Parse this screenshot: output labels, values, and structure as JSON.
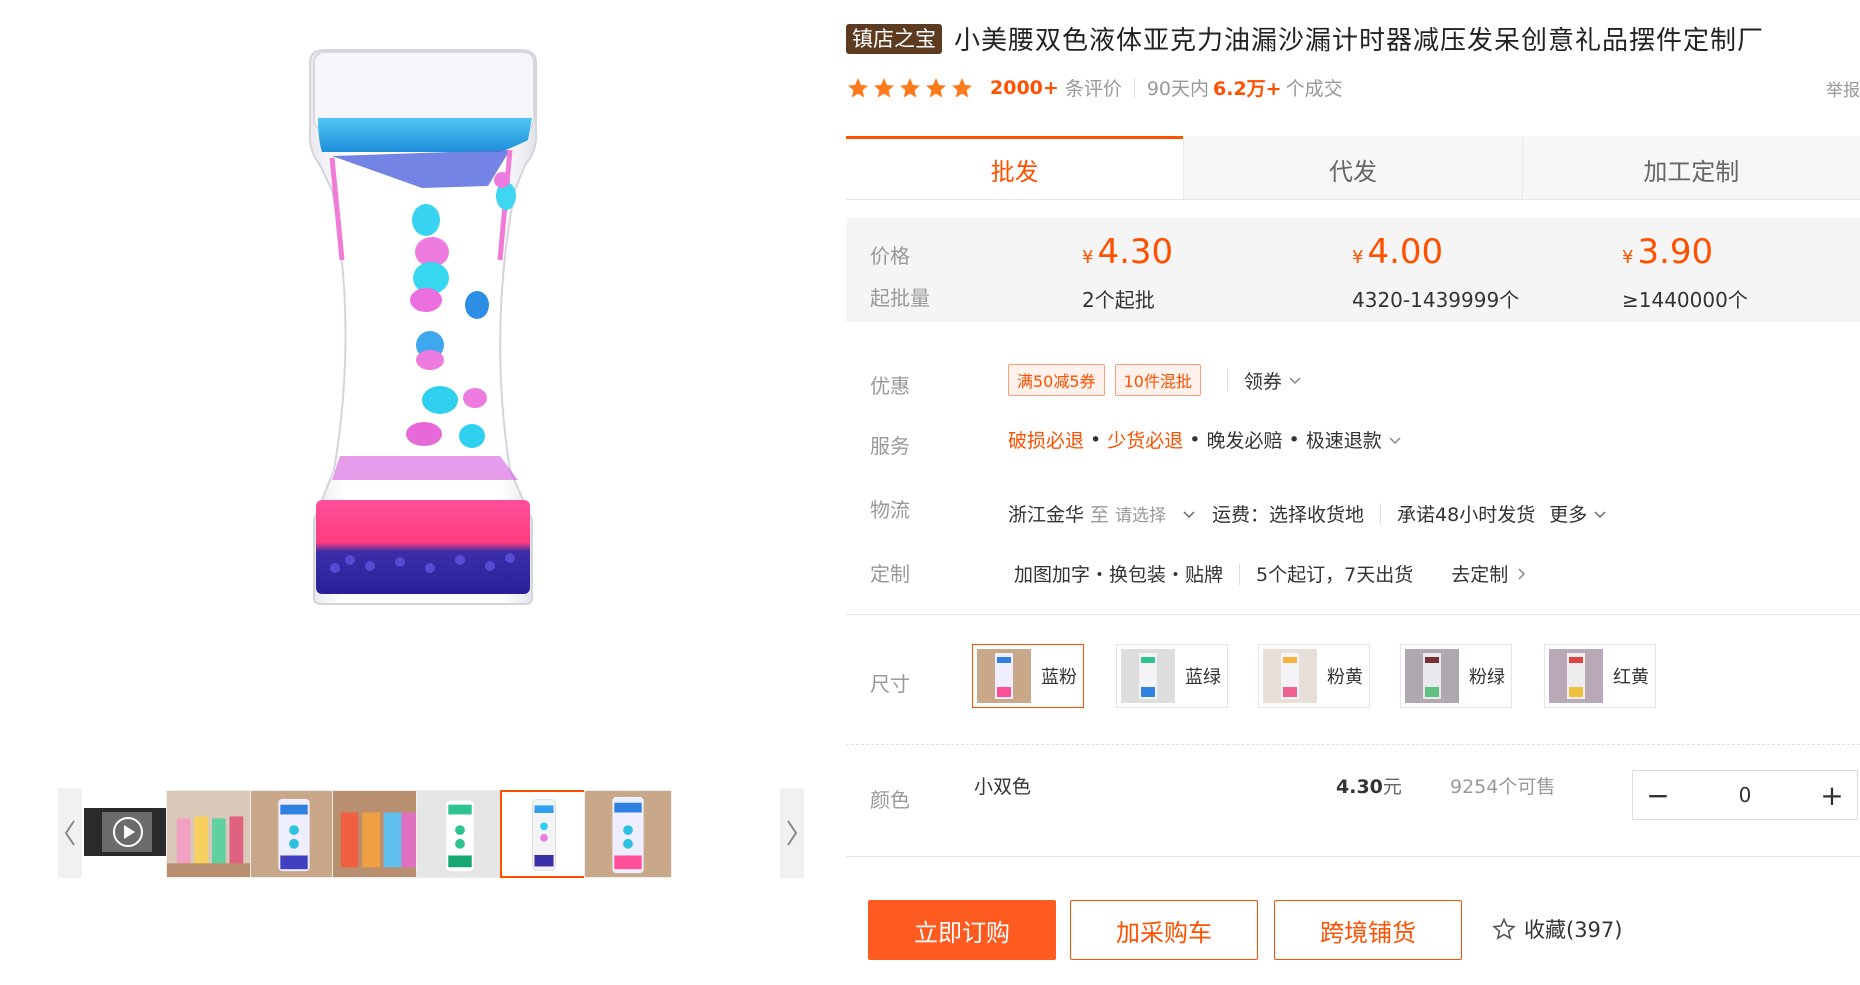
{
  "product": {
    "badge": "镇店之宝",
    "title": "小美腰双色液体亚克力油漏沙漏计时器减压发呆创意礼品摆件定制厂"
  },
  "rating": {
    "stars": 5,
    "review_count": "2000+",
    "review_label": "条评价",
    "sales_prefix": "90天内",
    "sales_count": "6.2万+",
    "sales_suffix": "个成交",
    "report": "举报"
  },
  "tabs": [
    "批发",
    "代发",
    "加工定制"
  ],
  "price_box": {
    "price_label": "价格",
    "qty_label": "起批量",
    "currency": "¥",
    "tiers": [
      {
        "price": "4.30",
        "qty": "2个起批"
      },
      {
        "price": "4.00",
        "qty": "4320-1439999个"
      },
      {
        "price": "3.90",
        "qty": "≥1440000个"
      }
    ]
  },
  "discount": {
    "label": "优惠",
    "coupons": [
      "满50减5券",
      "10件混批"
    ],
    "get_coupon": "领券"
  },
  "service": {
    "label": "服务",
    "items": [
      "破损必退",
      "少货必退",
      "晚发必赔",
      "极速退款"
    ]
  },
  "logistics": {
    "label": "物流",
    "origin": "浙江金华",
    "to": "至",
    "select": "请选择",
    "fee": "运费：选择收货地",
    "promise": "承诺48小时发货",
    "more": "更多"
  },
  "custom": {
    "label": "定制",
    "options": "加图加字・换包装・贴牌",
    "terms": "5个起订，7天出货",
    "go": "去定制"
  },
  "size": {
    "label": "尺寸",
    "options": [
      "蓝粉",
      "蓝绿",
      "粉黄",
      "粉绿",
      "红黄"
    ],
    "selected": 0
  },
  "color_row": {
    "label": "颜色",
    "name": "小双色",
    "price": "4.30",
    "price_unit": "元",
    "stock": "9254个可售",
    "qty": "0",
    "minus": "−",
    "plus": "+"
  },
  "actions": {
    "buy": "立即订购",
    "cart": "加采购车",
    "cross": "跨境铺货",
    "fav": "收藏(397)"
  },
  "colors": {
    "accent": "#ff5000",
    "badge": "#5d3b21"
  }
}
